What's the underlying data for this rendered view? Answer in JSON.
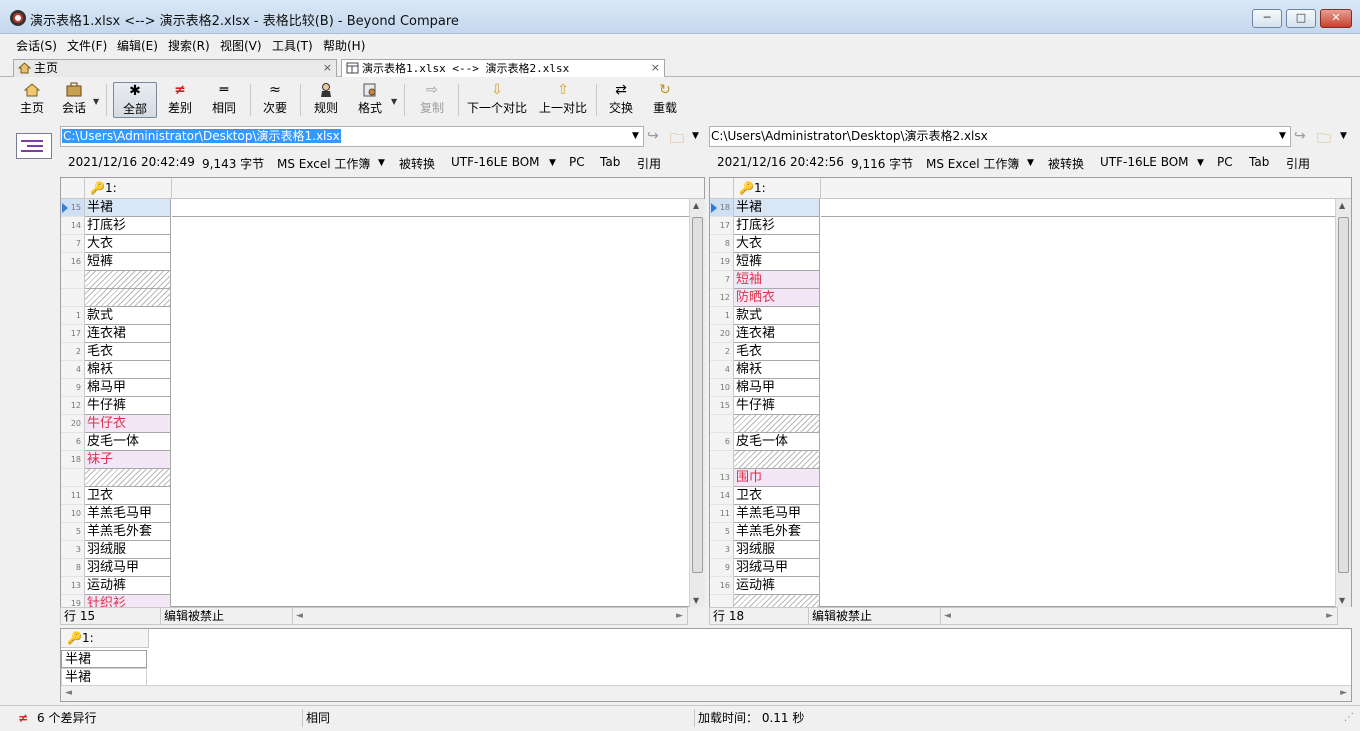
{
  "window": {
    "title": "演示表格1.xlsx <--> 演示表格2.xlsx - 表格比较(B) - Beyond Compare",
    "min": "─",
    "max": "□",
    "close": "✕"
  },
  "menu": [
    "会话(S)",
    "文件(F)",
    "编辑(E)",
    "搜索(R)",
    "视图(V)",
    "工具(T)",
    "帮助(H)"
  ],
  "tabs": [
    {
      "label": "主页",
      "close": "×",
      "icon": "home-icon"
    },
    {
      "label": "演示表格1.xlsx <--> 演示表格2.xlsx",
      "close": "×",
      "icon": "table-compare-icon"
    }
  ],
  "toolbar": {
    "home": "主页",
    "session": "会话",
    "all": "全部",
    "diffs": "差别",
    "same": "相同",
    "minor": "次要",
    "rules": "规则",
    "format": "格式",
    "copy": "复制",
    "next_diff": "下一个对比",
    "prev_diff": "上一对比",
    "swap": "交换",
    "reload": "重载",
    "icons": {
      "all": "✱",
      "diffs": "≠",
      "same": "═",
      "minor": "≈"
    }
  },
  "left": {
    "path": "C:\\Users\\Administrator\\Desktop\\演示表格1.xlsx",
    "date": "2021/12/16 20:42:49",
    "size": "9,143 字节",
    "format": "MS Excel 工作簿",
    "converted": "被转换",
    "encoding": "UTF-16LE BOM",
    "lineend": "PC",
    "tab": "Tab",
    "quote": "引用",
    "col_header": "1:",
    "rows": [
      {
        "n": "15",
        "v": "半裙",
        "t": "cur"
      },
      {
        "n": "14",
        "v": "打底衫",
        "t": ""
      },
      {
        "n": "7",
        "v": "大衣",
        "t": ""
      },
      {
        "n": "16",
        "v": "短裤",
        "t": ""
      },
      {
        "n": "",
        "v": "",
        "t": "empty"
      },
      {
        "n": "",
        "v": "",
        "t": "empty"
      },
      {
        "n": "1",
        "v": "款式",
        "t": ""
      },
      {
        "n": "17",
        "v": "连衣裙",
        "t": ""
      },
      {
        "n": "2",
        "v": "毛衣",
        "t": ""
      },
      {
        "n": "4",
        "v": "棉袄",
        "t": ""
      },
      {
        "n": "9",
        "v": "棉马甲",
        "t": ""
      },
      {
        "n": "12",
        "v": "牛仔裤",
        "t": ""
      },
      {
        "n": "20",
        "v": "牛仔衣",
        "t": "diff"
      },
      {
        "n": "6",
        "v": "皮毛一体",
        "t": ""
      },
      {
        "n": "18",
        "v": "袜子",
        "t": "diff"
      },
      {
        "n": "",
        "v": "",
        "t": "empty"
      },
      {
        "n": "11",
        "v": "卫衣",
        "t": ""
      },
      {
        "n": "10",
        "v": "羊羔毛马甲",
        "t": ""
      },
      {
        "n": "5",
        "v": "羊羔毛外套",
        "t": ""
      },
      {
        "n": "3",
        "v": "羽绒服",
        "t": ""
      },
      {
        "n": "8",
        "v": "羽绒马甲",
        "t": ""
      },
      {
        "n": "13",
        "v": "运动裤",
        "t": ""
      },
      {
        "n": "19",
        "v": "针织衫",
        "t": "diff"
      }
    ],
    "status_row": "行 15",
    "status_edit": "编辑被禁止"
  },
  "right": {
    "path": "C:\\Users\\Administrator\\Desktop\\演示表格2.xlsx",
    "date": "2021/12/16 20:42:56",
    "size": "9,116 字节",
    "format": "MS Excel 工作簿",
    "converted": "被转换",
    "encoding": "UTF-16LE BOM",
    "lineend": "PC",
    "tab": "Tab",
    "quote": "引用",
    "col_header": "1:",
    "rows": [
      {
        "n": "18",
        "v": "半裙",
        "t": "cur"
      },
      {
        "n": "17",
        "v": "打底衫",
        "t": ""
      },
      {
        "n": "8",
        "v": "大衣",
        "t": ""
      },
      {
        "n": "19",
        "v": "短裤",
        "t": ""
      },
      {
        "n": "7",
        "v": "短袖",
        "t": "diff"
      },
      {
        "n": "12",
        "v": "防晒衣",
        "t": "diff"
      },
      {
        "n": "1",
        "v": "款式",
        "t": ""
      },
      {
        "n": "20",
        "v": "连衣裙",
        "t": ""
      },
      {
        "n": "2",
        "v": "毛衣",
        "t": ""
      },
      {
        "n": "4",
        "v": "棉袄",
        "t": ""
      },
      {
        "n": "10",
        "v": "棉马甲",
        "t": ""
      },
      {
        "n": "15",
        "v": "牛仔裤",
        "t": ""
      },
      {
        "n": "",
        "v": "",
        "t": "empty"
      },
      {
        "n": "6",
        "v": "皮毛一体",
        "t": ""
      },
      {
        "n": "",
        "v": "",
        "t": "empty"
      },
      {
        "n": "13",
        "v": "围巾",
        "t": "diff"
      },
      {
        "n": "14",
        "v": "卫衣",
        "t": ""
      },
      {
        "n": "11",
        "v": "羊羔毛马甲",
        "t": ""
      },
      {
        "n": "5",
        "v": "羊羔毛外套",
        "t": ""
      },
      {
        "n": "3",
        "v": "羽绒服",
        "t": ""
      },
      {
        "n": "9",
        "v": "羽绒马甲",
        "t": ""
      },
      {
        "n": "16",
        "v": "运动裤",
        "t": ""
      },
      {
        "n": "",
        "v": "",
        "t": "empty"
      }
    ],
    "status_row": "行 18",
    "status_edit": "编辑被禁止"
  },
  "merge": {
    "col_header": "1:",
    "line1": "半裙",
    "line2": "半裙"
  },
  "status": {
    "diff_icon": "≠",
    "diff_count": "6 个差异行",
    "same": "相同",
    "load_time": "加载时间：  0.11 秒"
  }
}
